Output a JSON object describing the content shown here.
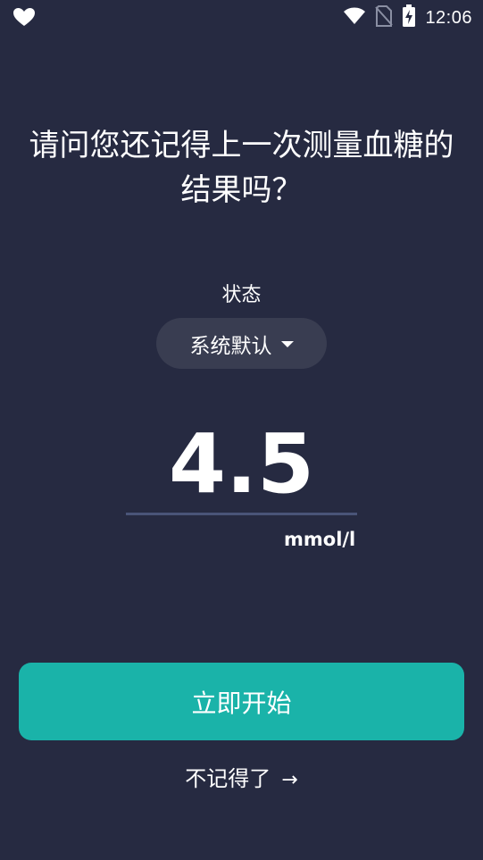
{
  "status_bar": {
    "time": "12:06",
    "left_icon": "heart-icon",
    "right_icons": [
      "wifi-icon",
      "no-sim-icon",
      "battery-charging-icon"
    ]
  },
  "main": {
    "question": "请问您还记得上一次测量血糖的结果吗？",
    "state_label": "状态",
    "state_dropdown": {
      "selected": "系统默认",
      "icon": "caret-down-icon"
    },
    "reading": {
      "value": "4.5",
      "unit": "mmol/l"
    },
    "start_button": "立即开始",
    "forget_link": {
      "label": "不记得了",
      "icon": "arrow-right-icon",
      "arrow": "→"
    }
  },
  "colors": {
    "background": "#262a41",
    "dropdown_bg": "#393d51",
    "accent": "#1ab3a9",
    "underline": "#4a5478",
    "text": "#ffffff"
  }
}
